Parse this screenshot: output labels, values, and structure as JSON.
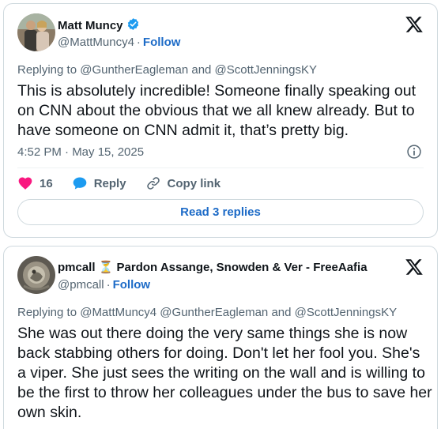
{
  "tweets": [
    {
      "author": {
        "name": "Matt Muncy",
        "handle": "@MattMuncy4",
        "verified": true
      },
      "follow_label": "Follow",
      "separator": "·",
      "replying_to": "Replying to @GuntherEagleman and @ScottJenningsKY",
      "text": "This is absolutely incredible! Someone finally speaking out on CNN about the obvious that we all knew already. But to have someone on CNN admit it, that’s pretty big.",
      "timestamp": "4:52 PM · May 15, 2025",
      "likes": "16",
      "reply_label": "Reply",
      "copy_link_label": "Copy link",
      "read_replies_label": "Read 3 replies"
    },
    {
      "author": {
        "name": "pmcall ⏳ Pardon Assange, Snowden & Ver - FreeAafia",
        "handle": "@pmcall",
        "verified": false
      },
      "follow_label": "Follow",
      "separator": "·",
      "replying_to": "Replying to @MattMuncy4 @GuntherEagleman and @ScottJenningsKY",
      "text": "She was out there doing the very same things she is now back stabbing others for doing. Don't let her fool you. She's a viper. She just sees the writing on the wall and is willing to be the first to throw her colleagues under the bus to save her own skin."
    }
  ],
  "colors": {
    "link": "#1d6bc7",
    "secondary_text": "#536471",
    "like": "#f91880",
    "verified": "#1d9bf0",
    "border": "#cfd9de"
  },
  "icons": [
    "verified-badge-icon",
    "x-logo-icon",
    "info-icon",
    "heart-icon",
    "reply-bubble-icon",
    "link-icon"
  ]
}
